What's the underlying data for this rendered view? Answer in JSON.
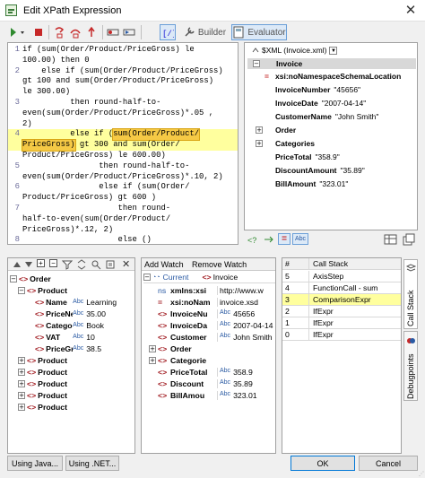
{
  "window": {
    "title": "Edit XPath Expression",
    "close_glyph": "✕"
  },
  "toolbar": {
    "builder_label": "Builder",
    "evaluator_label": "Evaluator"
  },
  "code_lines": [
    {
      "num": "1",
      "text": "if (sum(Order/Product/PriceGross) le"
    },
    {
      "num": "",
      "text": "100.00) then 0"
    },
    {
      "num": "2",
      "text": "    else if (sum(Order/Product/PriceGross)"
    },
    {
      "num": "",
      "text": "gt 100 and sum(Order/Product/PriceGross)"
    },
    {
      "num": "",
      "text": "le 300.00)"
    },
    {
      "num": "3",
      "text": "          then round-half-to-"
    },
    {
      "num": "",
      "text": "even(sum(Order/Product/PriceGross)*.05 ,"
    },
    {
      "num": "",
      "text": "2)"
    },
    {
      "num": "4",
      "text_pre": "          else if (",
      "text_hl": "sum(Order/Product/"
    },
    {
      "num": "",
      "text_hl": "PriceGross)",
      "text_post": " gt 300 and sum(Order/"
    },
    {
      "num": "",
      "text": "Product/PriceGross) le 600.00)"
    },
    {
      "num": "5",
      "text": "                then round-half-to-"
    },
    {
      "num": "",
      "text": "even(sum(Order/Product/PriceGross)*.10, 2)"
    },
    {
      "num": "6",
      "text": "                else if (sum(Order/"
    },
    {
      "num": "",
      "text": "Product/PriceGross) gt 600 )"
    },
    {
      "num": "7",
      "text": "                    then round-"
    },
    {
      "num": "",
      "text": "half-to-even(sum(Order/Product/"
    },
    {
      "num": "",
      "text": "PriceGross)*.12, 2)"
    },
    {
      "num": "8",
      "text": "                    else ()"
    }
  ],
  "result_tree": {
    "header": "$XML (Invoice.xml)",
    "root": "Invoice",
    "items": [
      {
        "label": "xsi:noNamespaceSchemaLocation",
        "value": "",
        "expand": "",
        "kind": "attr"
      },
      {
        "label": "InvoiceNumber",
        "value": "\"45656\"",
        "expand": "",
        "kind": "elem"
      },
      {
        "label": "InvoiceDate",
        "value": "\"2007-04-14\"",
        "expand": "",
        "kind": "elem"
      },
      {
        "label": "CustomerName",
        "value": "\"John Smith\"",
        "expand": "",
        "kind": "elem"
      },
      {
        "label": "Order",
        "value": "",
        "expand": "+",
        "kind": "elem"
      },
      {
        "label": "Categories",
        "value": "",
        "expand": "+",
        "kind": "elem"
      },
      {
        "label": "PriceTotal",
        "value": "\"358.9\"",
        "expand": "",
        "kind": "elem"
      },
      {
        "label": "DiscountAmount",
        "value": "\"35.89\"",
        "expand": "",
        "kind": "elem"
      },
      {
        "label": "BillAmount",
        "value": "\"323.01\"",
        "expand": "",
        "kind": "elem"
      }
    ],
    "status_abc": "Abc"
  },
  "xml_pane": {
    "rows": [
      {
        "exp": "−",
        "name": "Order",
        "abc": "",
        "val": "",
        "indent": 0
      },
      {
        "exp": "−",
        "name": "Product",
        "abc": "",
        "val": "",
        "indent": 1
      },
      {
        "exp": "",
        "name": "Name",
        "abc": "Abc",
        "val": "Learning",
        "indent": 2
      },
      {
        "exp": "",
        "name": "PriceNet",
        "abc": "Abc",
        "val": "35.00",
        "indent": 2
      },
      {
        "exp": "",
        "name": "Category",
        "abc": "Abc",
        "val": "Book",
        "indent": 2
      },
      {
        "exp": "",
        "name": "VAT",
        "abc": "Abc",
        "val": "10",
        "indent": 2
      },
      {
        "exp": "",
        "name": "PriceGross",
        "abc": "Abc",
        "val": "38.5",
        "indent": 2
      },
      {
        "exp": "+",
        "name": "Product",
        "abc": "",
        "val": "",
        "indent": 1
      },
      {
        "exp": "+",
        "name": "Product",
        "abc": "",
        "val": "",
        "indent": 1
      },
      {
        "exp": "+",
        "name": "Product",
        "abc": "",
        "val": "",
        "indent": 1
      },
      {
        "exp": "+",
        "name": "Product",
        "abc": "",
        "val": "",
        "indent": 1
      },
      {
        "exp": "+",
        "name": "Product",
        "abc": "",
        "val": "",
        "indent": 1
      }
    ]
  },
  "watch": {
    "add_label": "Add Watch",
    "remove_label": "Remove Watch",
    "col1": "Current",
    "col2": "Invoice",
    "rows": [
      {
        "exp": "",
        "name": "xmlns:xsi",
        "abc": "",
        "val": "http://www.w",
        "pfx": "ns"
      },
      {
        "exp": "",
        "name": "xsi:noNam",
        "abc": "",
        "val": "invoice.xsd",
        "pfx": "="
      },
      {
        "exp": "",
        "name": "InvoiceNu",
        "abc": "Abc",
        "val": "45656",
        "pfx": "<>"
      },
      {
        "exp": "",
        "name": "InvoiceDa",
        "abc": "Abc",
        "val": "2007-04-14",
        "pfx": "<>"
      },
      {
        "exp": "",
        "name": "Customer",
        "abc": "Abc",
        "val": "John Smith",
        "pfx": "<>"
      },
      {
        "exp": "+",
        "name": "Order",
        "abc": "",
        "val": "",
        "pfx": "<>"
      },
      {
        "exp": "+",
        "name": "Categorie",
        "abc": "",
        "val": "",
        "pfx": "<>"
      },
      {
        "exp": "",
        "name": "PriceTotal",
        "abc": "Abc",
        "val": "358.9",
        "pfx": "<>"
      },
      {
        "exp": "",
        "name": "Discount",
        "abc": "Abc",
        "val": "35.89",
        "pfx": "<>"
      },
      {
        "exp": "",
        "name": "BillAmou",
        "abc": "Abc",
        "val": "323.01",
        "pfx": "<>"
      }
    ]
  },
  "call_stack": {
    "col_num": "#",
    "col_title": "Call Stack",
    "rows": [
      {
        "n": "5",
        "t": "AxisStep"
      },
      {
        "n": "4",
        "t": "FunctionCall - sum"
      },
      {
        "n": "3",
        "t": "ComparisonExpr"
      },
      {
        "n": "2",
        "t": "IfExpr"
      },
      {
        "n": "1",
        "t": "IfExpr"
      },
      {
        "n": "0",
        "t": "IfExpr"
      }
    ]
  },
  "side_tabs": {
    "call_stack": "Call Stack",
    "debugpoints": "Debugpoints"
  },
  "buttons": {
    "java": "Using Java...",
    "net": "Using .NET...",
    "ok": "OK",
    "cancel": "Cancel"
  },
  "colors": {
    "highlight": "#ffff9e",
    "bracket": "#f5c945",
    "element": "#a0191f",
    "accent": "#0078d7"
  }
}
